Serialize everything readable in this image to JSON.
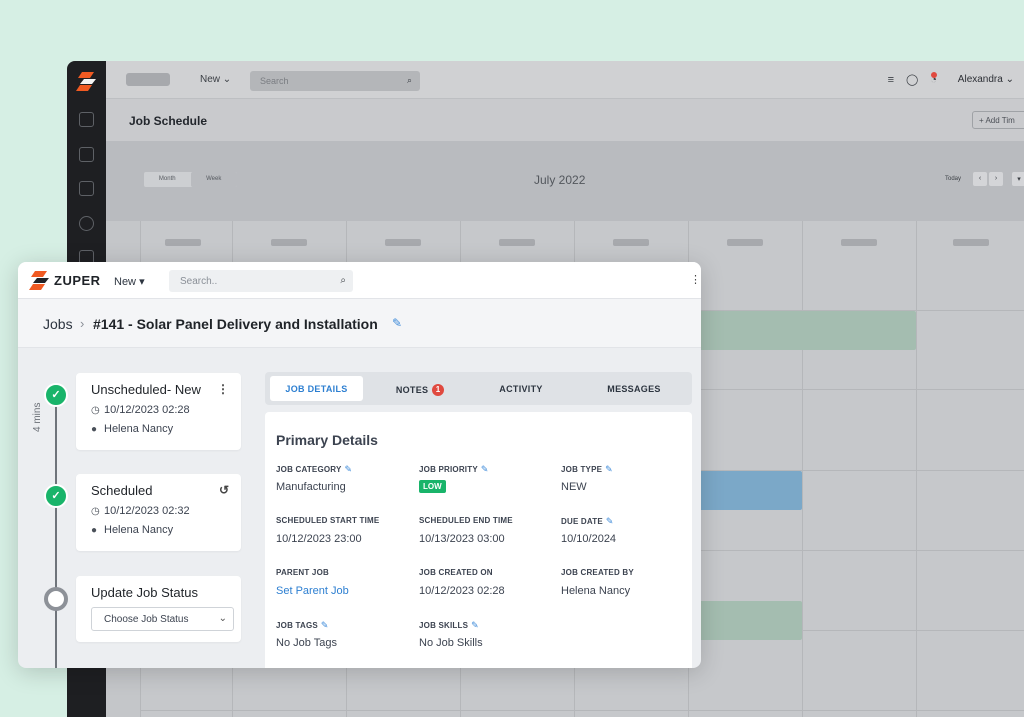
{
  "background_app": {
    "new_label": "New",
    "search_placeholder": "Search",
    "user_name": "Alexandra",
    "page_title": "Job Schedule",
    "add_button_label": "Add Tim",
    "view_tabs": [
      "Month",
      "Week"
    ],
    "month_title": "July 2022",
    "today_label": "Today"
  },
  "topbar": {
    "brand": "ZUPER",
    "new_label": "New",
    "search_placeholder": "Search.."
  },
  "breadcrumb": {
    "root": "Jobs",
    "title": "#141 - Solar Panel Delivery and Installation"
  },
  "timeline": {
    "duration_label": "4 mins",
    "statuses": [
      {
        "title": "Unscheduled- New",
        "datetime": "10/12/2023 02:28",
        "user": "Helena Nancy"
      },
      {
        "title": "Scheduled",
        "datetime": "10/12/2023 02:32",
        "user": "Helena Nancy"
      }
    ],
    "update": {
      "title": "Update Job Status",
      "placeholder": "Choose Job Status"
    }
  },
  "tabs": [
    {
      "label": "JOB DETAILS",
      "active": true
    },
    {
      "label": "NOTES",
      "badge": "1"
    },
    {
      "label": "ACTIVITY"
    },
    {
      "label": "MESSAGES"
    }
  ],
  "details": {
    "title": "Primary Details",
    "job_category": {
      "label": "JOB CATEGORY",
      "value": "Manufacturing"
    },
    "job_priority": {
      "label": "JOB PRIORITY",
      "value": "LOW"
    },
    "job_type": {
      "label": "JOB TYPE",
      "value": "NEW"
    },
    "scheduled_start": {
      "label": "SCHEDULED START TIME",
      "value": "10/12/2023 23:00"
    },
    "scheduled_end": {
      "label": "SCHEDULED END TIME",
      "value": "10/13/2023 03:00"
    },
    "due_date": {
      "label": "DUE DATE",
      "value": "10/10/2024"
    },
    "parent_job": {
      "label": "PARENT JOB",
      "value": "Set Parent Job"
    },
    "created_on": {
      "label": "JOB CREATED ON",
      "value": "10/12/2023 02:28"
    },
    "created_by": {
      "label": "JOB CREATED BY",
      "value": "Helena Nancy"
    },
    "job_tags": {
      "label": "JOB TAGS",
      "value": "No Job Tags"
    },
    "job_skills": {
      "label": "JOB SKILLS",
      "value": "No Job Skills"
    }
  },
  "colors": {
    "accent": "#2d7fd1",
    "success": "#19b46a",
    "badge": "#e0493f",
    "logo_orange": "#f05a22"
  }
}
